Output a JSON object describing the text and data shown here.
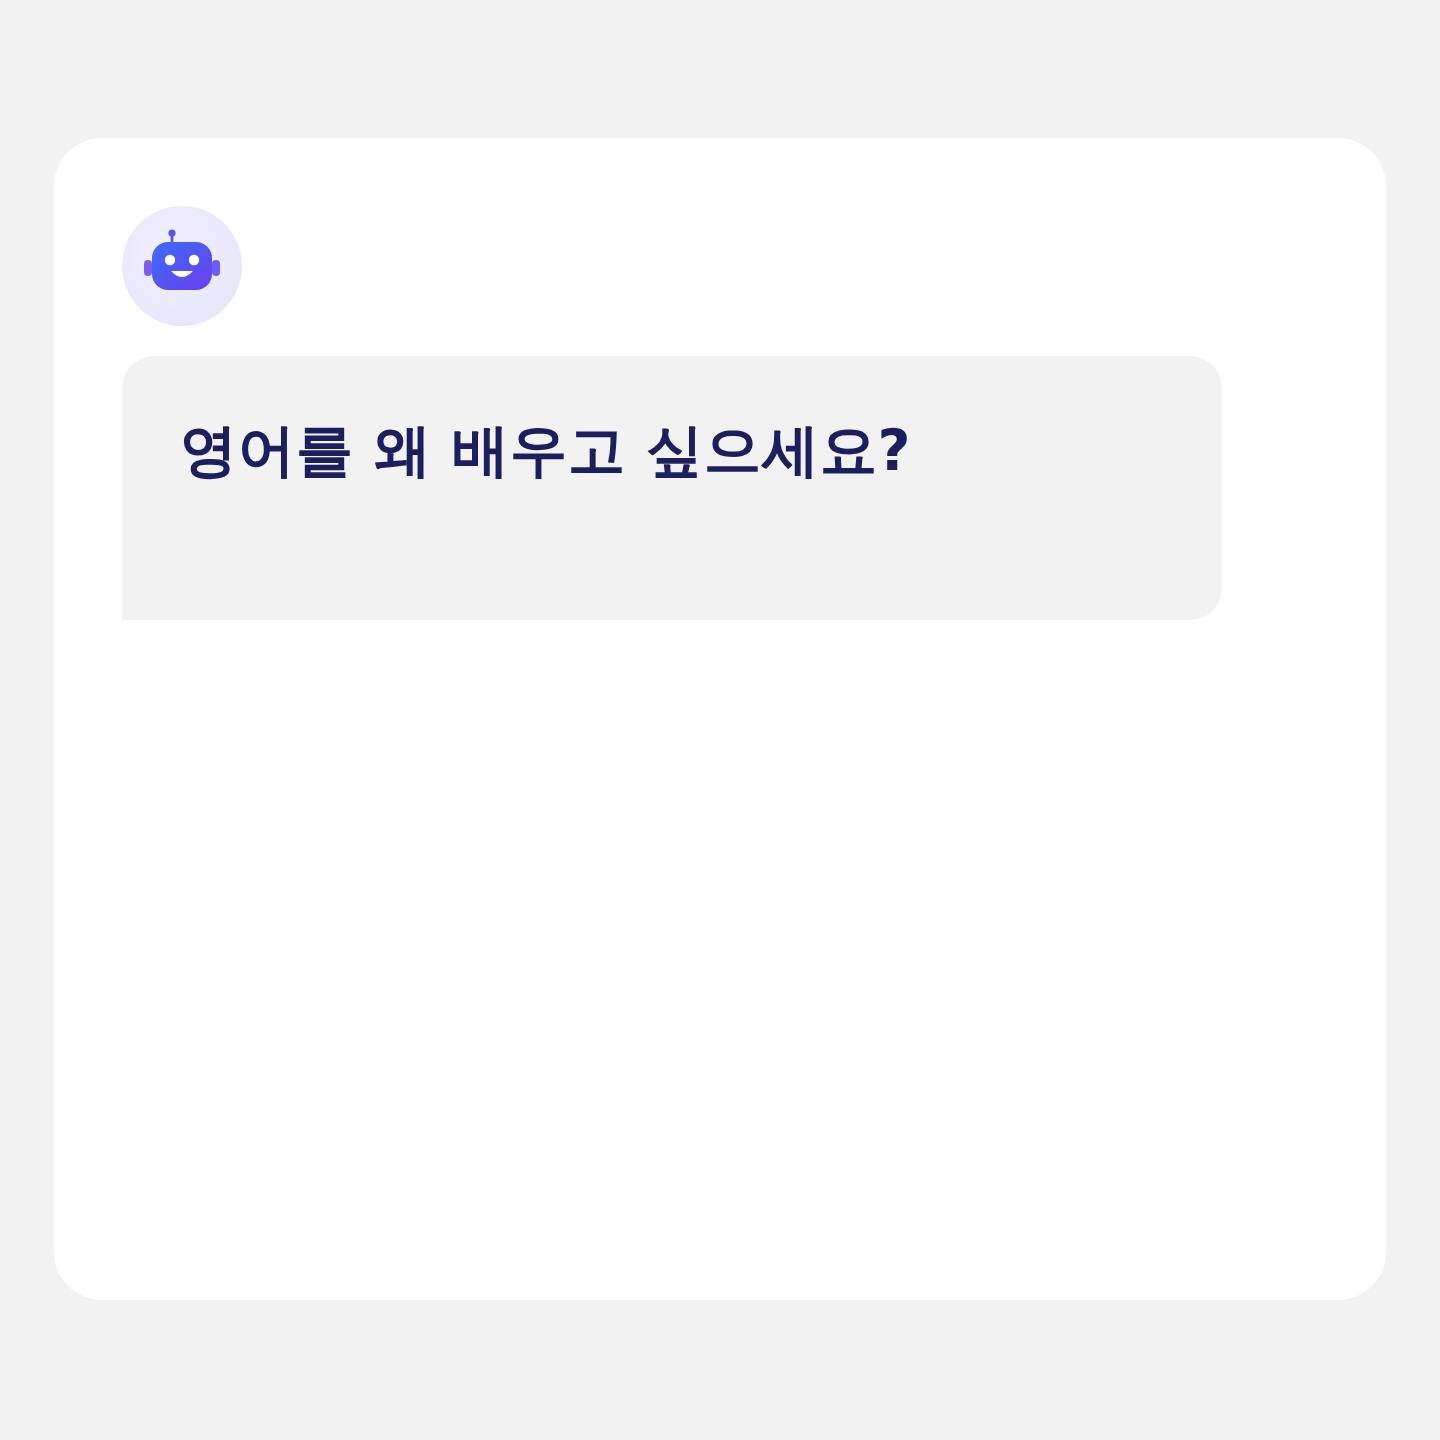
{
  "chat": {
    "message": {
      "text": "영어를 왜 배우고 싶으세요?"
    }
  }
}
